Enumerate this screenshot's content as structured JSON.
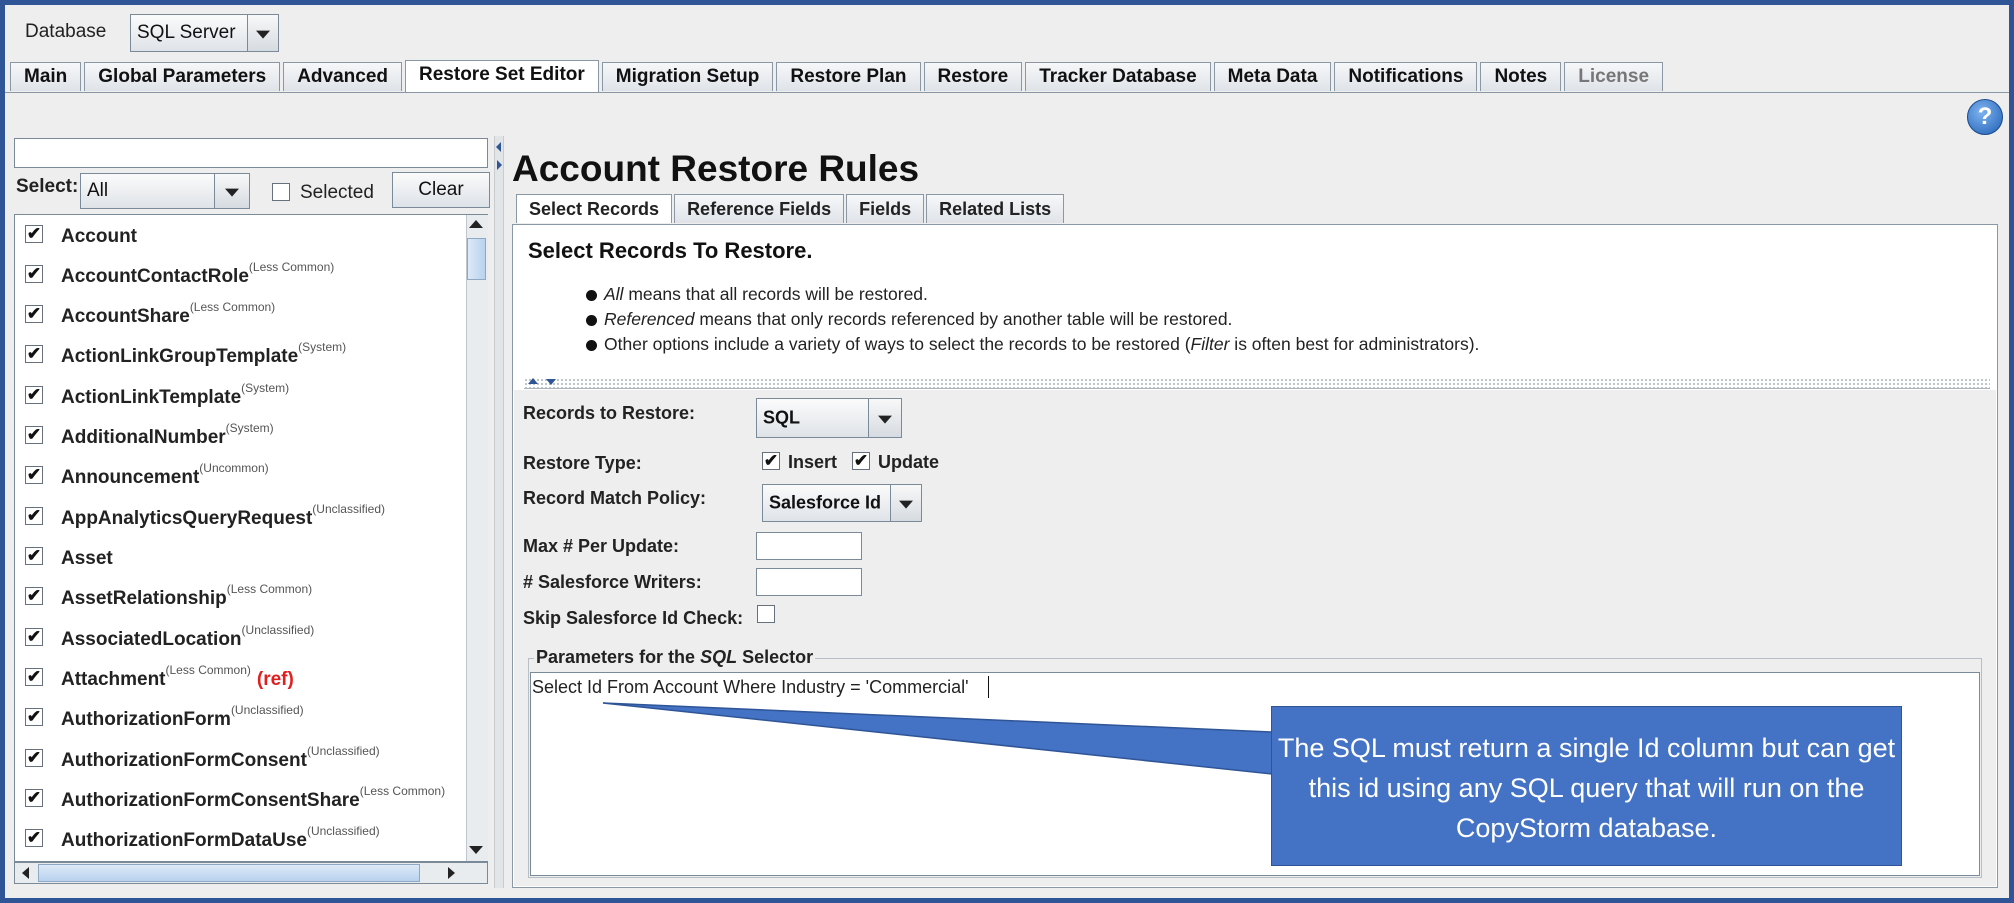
{
  "toolbar": {
    "database_label": "Database",
    "database_value": "SQL Server"
  },
  "tabs": [
    {
      "label": "Main"
    },
    {
      "label": "Global Parameters"
    },
    {
      "label": "Advanced"
    },
    {
      "label": "Restore Set Editor",
      "active": true
    },
    {
      "label": "Migration Setup"
    },
    {
      "label": "Restore Plan"
    },
    {
      "label": "Restore"
    },
    {
      "label": "Tracker Database"
    },
    {
      "label": "Meta Data"
    },
    {
      "label": "Notifications"
    },
    {
      "label": "Notes"
    },
    {
      "label": "License",
      "disabled": true
    }
  ],
  "help_icon": "?",
  "sidebar": {
    "filter_value": "",
    "select_label": "Select:",
    "select_value": "All",
    "selected_label": "Selected",
    "clear_label": "Clear",
    "items": [
      {
        "name": "Account",
        "tag": "",
        "ref": ""
      },
      {
        "name": "AccountContactRole",
        "tag": "(Less Common)",
        "ref": ""
      },
      {
        "name": "AccountShare",
        "tag": "(Less Common)",
        "ref": ""
      },
      {
        "name": "ActionLinkGroupTemplate",
        "tag": "(System)",
        "ref": ""
      },
      {
        "name": "ActionLinkTemplate",
        "tag": "(System)",
        "ref": ""
      },
      {
        "name": "AdditionalNumber",
        "tag": "(System)",
        "ref": ""
      },
      {
        "name": "Announcement",
        "tag": "(Uncommon)",
        "ref": ""
      },
      {
        "name": "AppAnalyticsQueryRequest",
        "tag": "(Unclassified)",
        "ref": ""
      },
      {
        "name": "Asset",
        "tag": "",
        "ref": ""
      },
      {
        "name": "AssetRelationship",
        "tag": "(Less Common)",
        "ref": ""
      },
      {
        "name": "AssociatedLocation",
        "tag": "(Unclassified)",
        "ref": ""
      },
      {
        "name": "Attachment",
        "tag": "(Less Common)",
        "ref": "(ref)"
      },
      {
        "name": "AuthorizationForm",
        "tag": "(Unclassified)",
        "ref": ""
      },
      {
        "name": "AuthorizationFormConsent",
        "tag": "(Unclassified)",
        "ref": ""
      },
      {
        "name": "AuthorizationFormConsentShare",
        "tag": "(Less Common)",
        "ref": ""
      },
      {
        "name": "AuthorizationFormDataUse",
        "tag": "(Unclassified)",
        "ref": ""
      }
    ]
  },
  "main": {
    "title": "Account Restore Rules",
    "subtabs": [
      {
        "label": "Select Records",
        "active": true
      },
      {
        "label": "Reference Fields"
      },
      {
        "label": "Fields"
      },
      {
        "label": "Related Lists"
      }
    ],
    "section_title": "Select Records To Restore.",
    "bullets": [
      {
        "em": "All",
        "text": " means that all records will be restored."
      },
      {
        "em": "Referenced",
        "text": " means that only records referenced by another table will be restored."
      },
      {
        "pre": "Other options include a variety of ways to select the records to be restored (",
        "em": "Filter",
        "text": " is often best for administrators)."
      }
    ],
    "form": {
      "records_label": "Records to Restore:",
      "records_value": "SQL",
      "restore_type_label": "Restore Type:",
      "insert_label": "Insert",
      "update_label": "Update",
      "match_policy_label": "Record Match Policy:",
      "match_policy_value": "Salesforce Id",
      "max_per_update_label": "Max # Per Update:",
      "max_per_update_value": "",
      "writers_label": "# Salesforce Writers:",
      "writers_value": "",
      "skip_check_label": "Skip Salesforce Id Check:",
      "params_prefix": "Parameters for the ",
      "params_em": "SQL",
      "params_suffix": " Selector",
      "sql_text": "Select Id From Account Where Industry = 'Commercial'"
    },
    "callout": "The SQL must return a single Id column but can get this id using any SQL query that will run on the CopyStorm database."
  },
  "colors": {
    "frame": "#2f5597",
    "callout": "#4472c4",
    "ref": "#e02020"
  }
}
